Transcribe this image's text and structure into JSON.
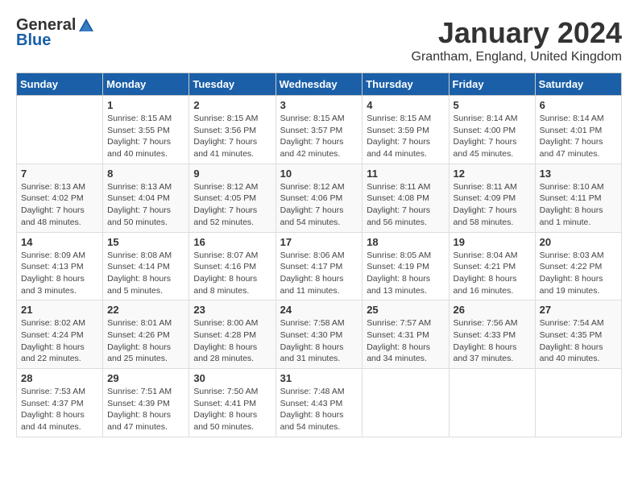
{
  "logo": {
    "general": "General",
    "blue": "Blue"
  },
  "title": "January 2024",
  "subtitle": "Grantham, England, United Kingdom",
  "days_header": [
    "Sunday",
    "Monday",
    "Tuesday",
    "Wednesday",
    "Thursday",
    "Friday",
    "Saturday"
  ],
  "weeks": [
    [
      {
        "day": "",
        "sunrise": "",
        "sunset": "",
        "daylight": ""
      },
      {
        "day": "1",
        "sunrise": "Sunrise: 8:15 AM",
        "sunset": "Sunset: 3:55 PM",
        "daylight": "Daylight: 7 hours and 40 minutes."
      },
      {
        "day": "2",
        "sunrise": "Sunrise: 8:15 AM",
        "sunset": "Sunset: 3:56 PM",
        "daylight": "Daylight: 7 hours and 41 minutes."
      },
      {
        "day": "3",
        "sunrise": "Sunrise: 8:15 AM",
        "sunset": "Sunset: 3:57 PM",
        "daylight": "Daylight: 7 hours and 42 minutes."
      },
      {
        "day": "4",
        "sunrise": "Sunrise: 8:15 AM",
        "sunset": "Sunset: 3:59 PM",
        "daylight": "Daylight: 7 hours and 44 minutes."
      },
      {
        "day": "5",
        "sunrise": "Sunrise: 8:14 AM",
        "sunset": "Sunset: 4:00 PM",
        "daylight": "Daylight: 7 hours and 45 minutes."
      },
      {
        "day": "6",
        "sunrise": "Sunrise: 8:14 AM",
        "sunset": "Sunset: 4:01 PM",
        "daylight": "Daylight: 7 hours and 47 minutes."
      }
    ],
    [
      {
        "day": "7",
        "sunrise": "Sunrise: 8:13 AM",
        "sunset": "Sunset: 4:02 PM",
        "daylight": "Daylight: 7 hours and 48 minutes."
      },
      {
        "day": "8",
        "sunrise": "Sunrise: 8:13 AM",
        "sunset": "Sunset: 4:04 PM",
        "daylight": "Daylight: 7 hours and 50 minutes."
      },
      {
        "day": "9",
        "sunrise": "Sunrise: 8:12 AM",
        "sunset": "Sunset: 4:05 PM",
        "daylight": "Daylight: 7 hours and 52 minutes."
      },
      {
        "day": "10",
        "sunrise": "Sunrise: 8:12 AM",
        "sunset": "Sunset: 4:06 PM",
        "daylight": "Daylight: 7 hours and 54 minutes."
      },
      {
        "day": "11",
        "sunrise": "Sunrise: 8:11 AM",
        "sunset": "Sunset: 4:08 PM",
        "daylight": "Daylight: 7 hours and 56 minutes."
      },
      {
        "day": "12",
        "sunrise": "Sunrise: 8:11 AM",
        "sunset": "Sunset: 4:09 PM",
        "daylight": "Daylight: 7 hours and 58 minutes."
      },
      {
        "day": "13",
        "sunrise": "Sunrise: 8:10 AM",
        "sunset": "Sunset: 4:11 PM",
        "daylight": "Daylight: 8 hours and 1 minute."
      }
    ],
    [
      {
        "day": "14",
        "sunrise": "Sunrise: 8:09 AM",
        "sunset": "Sunset: 4:13 PM",
        "daylight": "Daylight: 8 hours and 3 minutes."
      },
      {
        "day": "15",
        "sunrise": "Sunrise: 8:08 AM",
        "sunset": "Sunset: 4:14 PM",
        "daylight": "Daylight: 8 hours and 5 minutes."
      },
      {
        "day": "16",
        "sunrise": "Sunrise: 8:07 AM",
        "sunset": "Sunset: 4:16 PM",
        "daylight": "Daylight: 8 hours and 8 minutes."
      },
      {
        "day": "17",
        "sunrise": "Sunrise: 8:06 AM",
        "sunset": "Sunset: 4:17 PM",
        "daylight": "Daylight: 8 hours and 11 minutes."
      },
      {
        "day": "18",
        "sunrise": "Sunrise: 8:05 AM",
        "sunset": "Sunset: 4:19 PM",
        "daylight": "Daylight: 8 hours and 13 minutes."
      },
      {
        "day": "19",
        "sunrise": "Sunrise: 8:04 AM",
        "sunset": "Sunset: 4:21 PM",
        "daylight": "Daylight: 8 hours and 16 minutes."
      },
      {
        "day": "20",
        "sunrise": "Sunrise: 8:03 AM",
        "sunset": "Sunset: 4:22 PM",
        "daylight": "Daylight: 8 hours and 19 minutes."
      }
    ],
    [
      {
        "day": "21",
        "sunrise": "Sunrise: 8:02 AM",
        "sunset": "Sunset: 4:24 PM",
        "daylight": "Daylight: 8 hours and 22 minutes."
      },
      {
        "day": "22",
        "sunrise": "Sunrise: 8:01 AM",
        "sunset": "Sunset: 4:26 PM",
        "daylight": "Daylight: 8 hours and 25 minutes."
      },
      {
        "day": "23",
        "sunrise": "Sunrise: 8:00 AM",
        "sunset": "Sunset: 4:28 PM",
        "daylight": "Daylight: 8 hours and 28 minutes."
      },
      {
        "day": "24",
        "sunrise": "Sunrise: 7:58 AM",
        "sunset": "Sunset: 4:30 PM",
        "daylight": "Daylight: 8 hours and 31 minutes."
      },
      {
        "day": "25",
        "sunrise": "Sunrise: 7:57 AM",
        "sunset": "Sunset: 4:31 PM",
        "daylight": "Daylight: 8 hours and 34 minutes."
      },
      {
        "day": "26",
        "sunrise": "Sunrise: 7:56 AM",
        "sunset": "Sunset: 4:33 PM",
        "daylight": "Daylight: 8 hours and 37 minutes."
      },
      {
        "day": "27",
        "sunrise": "Sunrise: 7:54 AM",
        "sunset": "Sunset: 4:35 PM",
        "daylight": "Daylight: 8 hours and 40 minutes."
      }
    ],
    [
      {
        "day": "28",
        "sunrise": "Sunrise: 7:53 AM",
        "sunset": "Sunset: 4:37 PM",
        "daylight": "Daylight: 8 hours and 44 minutes."
      },
      {
        "day": "29",
        "sunrise": "Sunrise: 7:51 AM",
        "sunset": "Sunset: 4:39 PM",
        "daylight": "Daylight: 8 hours and 47 minutes."
      },
      {
        "day": "30",
        "sunrise": "Sunrise: 7:50 AM",
        "sunset": "Sunset: 4:41 PM",
        "daylight": "Daylight: 8 hours and 50 minutes."
      },
      {
        "day": "31",
        "sunrise": "Sunrise: 7:48 AM",
        "sunset": "Sunset: 4:43 PM",
        "daylight": "Daylight: 8 hours and 54 minutes."
      },
      {
        "day": "",
        "sunrise": "",
        "sunset": "",
        "daylight": ""
      },
      {
        "day": "",
        "sunrise": "",
        "sunset": "",
        "daylight": ""
      },
      {
        "day": "",
        "sunrise": "",
        "sunset": "",
        "daylight": ""
      }
    ]
  ]
}
